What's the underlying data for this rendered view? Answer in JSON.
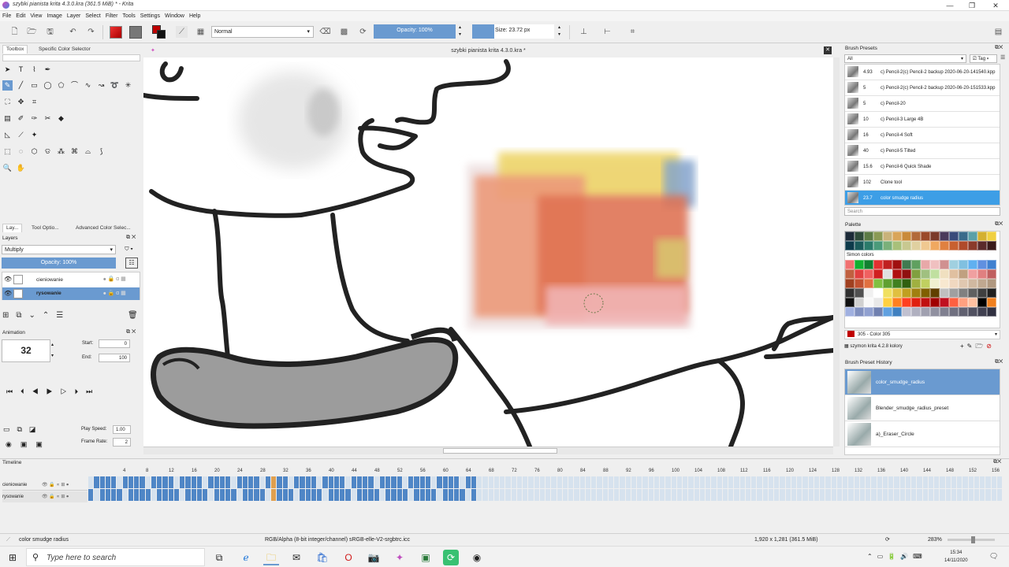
{
  "window": {
    "title": "szybki pianista krita 4.3.0.kra  (361.5 MiB)  * - Krita",
    "min": "—",
    "max": "❐",
    "close": "✕"
  },
  "menu": [
    "File",
    "Edit",
    "View",
    "Image",
    "Layer",
    "Select",
    "Filter",
    "Tools",
    "Settings",
    "Window",
    "Help"
  ],
  "toolbar": {
    "blend_mode": "Normal",
    "opacity": "Opacity: 100%",
    "size": "Size: 23.72 px"
  },
  "left_dock": {
    "tabs": [
      "Toolbox",
      "Specific Color Selector"
    ],
    "layer_tabs": [
      "Lay...",
      "Tool Optio...",
      "Advanced Color Selec..."
    ],
    "layers_title": "Layers",
    "layer_blend": "Multiply",
    "layer_opacity": "Opacity:  100%",
    "layers": [
      {
        "name": "cieniowanie",
        "selected": false
      },
      {
        "name": "rysowanie",
        "selected": true
      }
    ],
    "animation_title": "Animation",
    "current_frame": "32",
    "start_label": "Start:",
    "start": "0",
    "end_label": "End:",
    "end": "100",
    "play_speed_label": "Play Speed:",
    "play_speed": "1.00",
    "frame_rate_label": "Frame Rate:",
    "frame_rate": "2"
  },
  "document_tab": "szybki pianista krita 4.3.0.kra *",
  "brush_presets": {
    "title": "Brush Presets",
    "filter": "All",
    "tag_label": "Tag",
    "search_placeholder": "Search",
    "items": [
      {
        "size": "4.93",
        "name": "c) Pencil-2(c) Pencil-2 backup 2020-06-20-141540.kpp"
      },
      {
        "size": "5",
        "name": "c) Pencil-2(c) Pencil-2 backup 2020-06-20-151533.kpp"
      },
      {
        "size": "5",
        "name": "c) Pencil-20"
      },
      {
        "size": "10",
        "name": "c) Pencil-3 Large 4B"
      },
      {
        "size": "16",
        "name": "c) Pencil-4 Soft"
      },
      {
        "size": "40",
        "name": "c) Pencil-5 Tilted"
      },
      {
        "size": "15.6",
        "name": "c) Pencil-6 Quick Shade"
      },
      {
        "size": "102",
        "name": "Clone tool"
      },
      {
        "size": "23.7",
        "name": "color smudge radius",
        "selected": true
      }
    ]
  },
  "palette": {
    "title": "Palette",
    "group": "Simon colors",
    "current_color": "305 - Color 305",
    "palette_name": "szymon krita 4.2.8 kolory",
    "top_row": [
      "#1c2a38",
      "#2e4a3a",
      "#5b7a45",
      "#8a9a55",
      "#c9b27a",
      "#d9a55a",
      "#c98a3a",
      "#b26a3a",
      "#9a4a2a",
      "#7a3a2a",
      "#4a3a5a",
      "#3a4a7a",
      "#3a6a8a",
      "#5aa0a8",
      "#d4b030",
      "#f0d040"
    ],
    "second_row": [
      "#0d3a4a",
      "#1a5a5a",
      "#2a7a6a",
      "#4a9a7a",
      "#7ab07a",
      "#a8c07a",
      "#c8c890",
      "#e0d0a0",
      "#f0c890",
      "#f0a860",
      "#e08040",
      "#c86030",
      "#b04a2a",
      "#8a3a2a",
      "#5a2a2a",
      "#3a1a1a"
    ],
    "grid": [
      "#f07070",
      "#10b030",
      "#108030",
      "#e03030",
      "#c02020",
      "#a01010",
      "#407a50",
      "#60a060",
      "#e8a8a8",
      "#f0c0c0",
      "#d09090",
      "#a0d0e0",
      "#80c0e0",
      "#60b0f0",
      "#6090e0",
      "#4080d0",
      "#c06040",
      "#e04040",
      "#f06060",
      "#d02020",
      "#e0e0e0",
      "#b01010",
      "#901010",
      "#80a040",
      "#a0c080",
      "#c0e0a0",
      "#f0e0c0",
      "#e0c0a0",
      "#c0a080",
      "#f0a0a0",
      "#e08080",
      "#c06060",
      "#a04020",
      "#c05030",
      "#e07040",
      "#80c040",
      "#60a030",
      "#408020",
      "#306010",
      "#a0b040",
      "#c0d060",
      "#f0f0d0",
      "#f8e8d0",
      "#f0d8c0",
      "#e0c8b0",
      "#d0b8a0",
      "#c0a890",
      "#b09880",
      "#303030",
      "#505050",
      "#f0f0f0",
      "#ffffff",
      "#f0e060",
      "#e0c040",
      "#c0a020",
      "#a08010",
      "#806000",
      "#604000",
      "#c0c0c0",
      "#a0a0a0",
      "#808080",
      "#606060",
      "#404040",
      "#202020",
      "#101010",
      "#d0d0d0",
      "#f8f8f8",
      "#e8e8e8",
      "#ffd040",
      "#ff8020",
      "#ff4020",
      "#e02010",
      "#c01010",
      "#a00000",
      "#c01020",
      "#ff6040",
      "#ffa080",
      "#ffc0a0",
      "#000000",
      "#f08020",
      "#a0b0e0",
      "#8090c0",
      "#90a0d0",
      "#7080b0",
      "#60a0e0",
      "#4080c0",
      "#c0c0d0",
      "#b0b0c0",
      "#a0a0b0",
      "#9090a0",
      "#808090",
      "#707080",
      "#606070",
      "#505060",
      "#404050",
      "#303040"
    ],
    "selected_color": "#c00000"
  },
  "brush_history": {
    "title": "Brush Preset History",
    "items": [
      "color_smudge_radius",
      "Blender_smudge_radius_preset",
      "a)_Eraser_Circle"
    ]
  },
  "timeline": {
    "title": "Timeline",
    "layers": [
      "cieniowanie",
      "rysowanie"
    ],
    "ruler": [
      "4",
      "8",
      "12",
      "16",
      "20",
      "24",
      "28",
      "32",
      "36",
      "40",
      "44",
      "48",
      "52",
      "56",
      "60",
      "64",
      "68",
      "72",
      "76",
      "80",
      "84",
      "88",
      "92",
      "96",
      "100",
      "104",
      "108",
      "112",
      "116",
      "120",
      "124",
      "128",
      "132",
      "136",
      "140",
      "144",
      "148",
      "152",
      "156"
    ]
  },
  "status": {
    "brush": "color smudge radius",
    "color_space": "RGB/Alpha (8-bit integer/channel)  sRGB-elle-V2-srgbtrc.icc",
    "dims": "1,920 x 1,281 (361.5 MiB)",
    "zoom": "283%"
  },
  "taskbar": {
    "search_placeholder": "Type here to search",
    "time": "15:34",
    "date": "14/11/2020"
  }
}
